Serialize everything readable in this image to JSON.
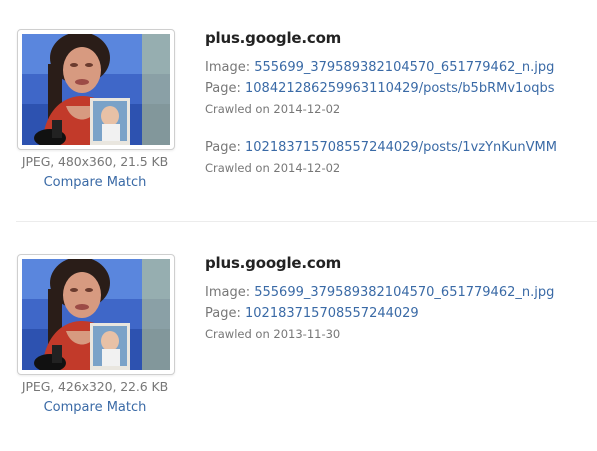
{
  "results": [
    {
      "thumbnail": {
        "meta": "JPEG, 480x360, 21.5 KB",
        "compare_label": "Compare Match"
      },
      "domain": "plus.google.com",
      "image_label": "Image:",
      "image_link": "555699_379589382104570_651779462_n.jpg",
      "pages": [
        {
          "label": "Page:",
          "link": "108421286259963110429/posts/b5bRMv1oqbs",
          "crawled": "Crawled on 2014-12-02"
        },
        {
          "label": "Page:",
          "link": "102183715708557244029/posts/1vzYnKunVMM",
          "crawled": "Crawled on 2014-12-02"
        }
      ]
    },
    {
      "thumbnail": {
        "meta": "JPEG, 426x320, 22.6 KB",
        "compare_label": "Compare Match"
      },
      "domain": "plus.google.com",
      "image_label": "Image:",
      "image_link": "555699_379589382104570_651779462_n.jpg",
      "pages": [
        {
          "label": "Page:",
          "link": "102183715708557244029",
          "crawled": "Crawled on 2013-11-30"
        }
      ]
    }
  ]
}
